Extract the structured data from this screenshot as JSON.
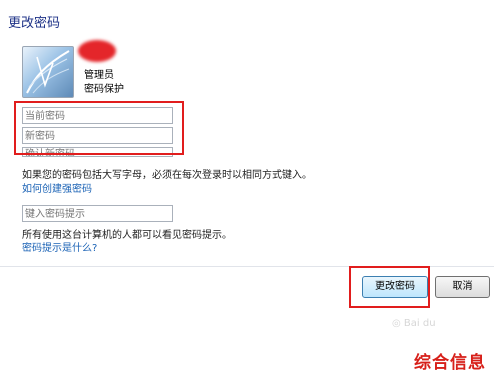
{
  "page": {
    "title": "更改密码"
  },
  "user": {
    "name": "管理员",
    "role": "密码保护"
  },
  "fields": {
    "current_password": {
      "placeholder": "当前密码"
    },
    "new_password": {
      "placeholder": "新密码"
    },
    "confirm_password": {
      "placeholder": "确认新密码"
    },
    "hint": {
      "placeholder": "键入密码提示"
    }
  },
  "notes": {
    "case_warning": "如果您的密码包括大写字母，必须在每次登录时以相同方式键入。",
    "strong_password_link": "如何创建强密码",
    "hint_visibility": "所有使用这台计算机的人都可以看见密码提示。",
    "what_is_hint_link": "密码提示是什么?"
  },
  "buttons": {
    "change": "更改密码",
    "cancel": "取消"
  },
  "watermark": {
    "text": "综合信息"
  },
  "colors": {
    "title": "#1e3287",
    "link": "#1a62b5",
    "highlight": "#e11d1d",
    "watermark": "#d7201a"
  }
}
